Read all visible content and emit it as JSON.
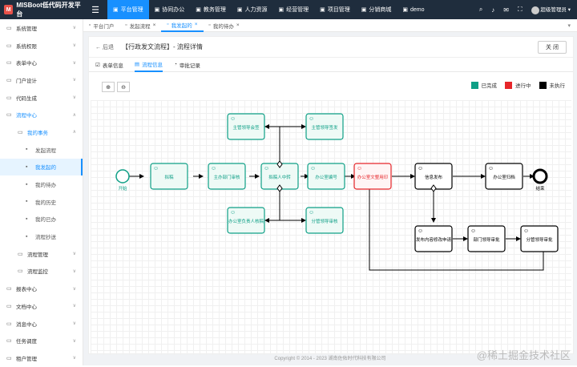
{
  "app": {
    "title": "MISBoot低代码开发平台"
  },
  "topnav": [
    {
      "label": "平台管理",
      "active": true
    },
    {
      "label": "协同办公"
    },
    {
      "label": "教务管理"
    },
    {
      "label": "人力资源"
    },
    {
      "label": "经营管理"
    },
    {
      "label": "项目管理"
    },
    {
      "label": "分销商城"
    },
    {
      "label": "demo"
    }
  ],
  "user": {
    "name": "超级管理员"
  },
  "sidebar": [
    {
      "label": "系统管理",
      "level": 1,
      "chev": "∨"
    },
    {
      "label": "系统权限",
      "level": 1,
      "chev": "∨"
    },
    {
      "label": "表单中心",
      "level": 1,
      "chev": "∨"
    },
    {
      "label": "门户设计",
      "level": 1,
      "chev": "∨"
    },
    {
      "label": "代码生成",
      "level": 1,
      "chev": "∨"
    },
    {
      "label": "流程中心",
      "level": 1,
      "chev": "∧",
      "blue": true
    },
    {
      "label": "我的事务",
      "level": 2,
      "chev": "∧",
      "blue": true
    },
    {
      "label": "发起流程",
      "level": 3
    },
    {
      "label": "我发起的",
      "level": 3,
      "selected": true
    },
    {
      "label": "我的待办",
      "level": 3
    },
    {
      "label": "我的历史",
      "level": 3
    },
    {
      "label": "我的已办",
      "level": 3
    },
    {
      "label": "流程抄送",
      "level": 3
    },
    {
      "label": "流程管理",
      "level": 2,
      "chev": "∨"
    },
    {
      "label": "流程监控",
      "level": 2,
      "chev": "∨"
    },
    {
      "label": "报表中心",
      "level": 1,
      "chev": "∨"
    },
    {
      "label": "文档中心",
      "level": 1,
      "chev": "∨"
    },
    {
      "label": "消息中心",
      "level": 1,
      "chev": "∨"
    },
    {
      "label": "任务调度",
      "level": 1,
      "chev": "∨"
    },
    {
      "label": "租户管理",
      "level": 1,
      "chev": "∨"
    }
  ],
  "pagetabs": [
    {
      "label": "平台门户"
    },
    {
      "label": "发起流程",
      "close": "×"
    },
    {
      "label": "我发起的",
      "close": "×",
      "active": true
    },
    {
      "label": "我的待办",
      "close": "×"
    }
  ],
  "header": {
    "back": "← 后退",
    "title": "【行政发文流程】- 流程详情",
    "close": "关 闭"
  },
  "subtabs": [
    {
      "label": "表单信息"
    },
    {
      "label": "流程信息",
      "active": true
    },
    {
      "label": "审批记录"
    }
  ],
  "legend": [
    {
      "label": "已完成",
      "color": "#0e9f86"
    },
    {
      "label": "进行中",
      "color": "#e6262a"
    },
    {
      "label": "未执行",
      "color": "#000000"
    }
  ],
  "flow": {
    "nodes": [
      {
        "id": "start",
        "label": "开始",
        "status": "done"
      },
      {
        "id": "n1",
        "label": "拟稿",
        "status": "done"
      },
      {
        "id": "n2",
        "label": "主办部门审核",
        "status": "done"
      },
      {
        "id": "n3",
        "label": "拟稿人中转",
        "status": "done"
      },
      {
        "id": "n4",
        "label": "主管领导会签",
        "status": "done"
      },
      {
        "id": "n5",
        "label": "主管领导签发",
        "status": "done"
      },
      {
        "id": "n6",
        "label": "办公室编号",
        "status": "done"
      },
      {
        "id": "n7",
        "label": "办公室负责人核稿",
        "status": "done"
      },
      {
        "id": "n8",
        "label": "分管领导审核",
        "status": "done"
      },
      {
        "id": "n9",
        "label": "办公室文整用印",
        "status": "active"
      },
      {
        "id": "n10",
        "label": "信息发布",
        "status": "todo"
      },
      {
        "id": "n11",
        "label": "办公室归档",
        "status": "todo"
      },
      {
        "id": "end",
        "label": "结束",
        "status": "todo"
      },
      {
        "id": "n12",
        "label": "发布内容修改申请",
        "status": "todo"
      },
      {
        "id": "n13",
        "label": "部门领导审批",
        "status": "todo"
      },
      {
        "id": "n14",
        "label": "分管领导审批",
        "status": "todo"
      }
    ]
  },
  "footer": "Copyright © 2014 - 2023 湖南佐佑时代科技有限公司",
  "watermark": "@稀土掘金技术社区"
}
